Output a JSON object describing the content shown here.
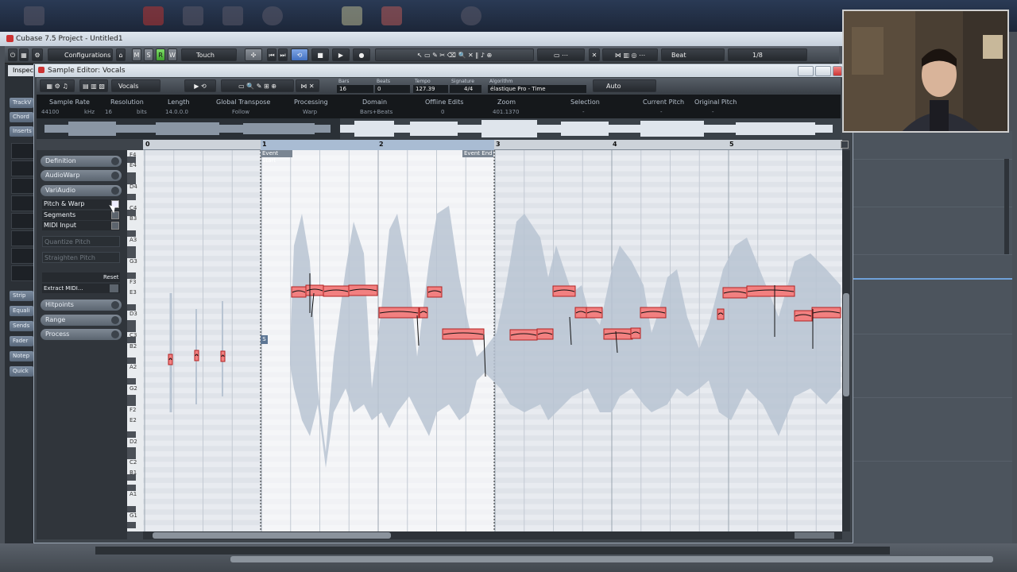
{
  "app": {
    "title": "Cubase 7.5 Project - Untitled1",
    "configurations": "Configurations",
    "automation_mode": "Touch",
    "snap_type": "Beat",
    "quantize": "1/8",
    "mode_buttons": [
      "M",
      "S",
      "R",
      "W"
    ]
  },
  "inspector": {
    "tab": "Inspec",
    "items": [
      "TrackV",
      "Chord",
      "Inserts",
      "Strip",
      "Equali",
      "Sends",
      "Fader",
      "Notep",
      "Quick"
    ]
  },
  "sample_editor": {
    "title": "Sample Editor: Vocals",
    "track": "Vocals",
    "bars_label": "Bars",
    "bars_value": "16",
    "beats_label": "Beats",
    "beats_value": "0",
    "tempo_label": "Tempo",
    "tempo_value": "127.39",
    "signature_label": "Signature",
    "signature_value": "4/4",
    "algorithm_label": "Algorithm",
    "algorithm_value": "élastique Pro - Time",
    "auto_label": "Auto",
    "info": [
      {
        "label": "Sample Rate",
        "value": "44100",
        "unit": "kHz"
      },
      {
        "label": "Resolution",
        "value": "16",
        "unit": "bits"
      },
      {
        "label": "Length",
        "value": "14.0.0.0",
        "unit": ""
      },
      {
        "label": "Global Transpose",
        "value": "Follow",
        "unit": ""
      },
      {
        "label": "Processing",
        "value": "Warp",
        "unit": ""
      },
      {
        "label": "Domain",
        "value": "Bars+Beats",
        "unit": ""
      },
      {
        "label": "Offline Edits",
        "value": "0",
        "unit": ""
      },
      {
        "label": "Zoom",
        "value": "401.1370",
        "unit": ""
      },
      {
        "label": "Selection",
        "value": "-",
        "unit": ""
      },
      {
        "label": "Current Pitch",
        "value": "-",
        "unit": ""
      },
      {
        "label": "Original Pitch",
        "value": "-",
        "unit": ""
      }
    ],
    "ruler_bars": [
      "0",
      "1",
      "2",
      "3",
      "4",
      "5"
    ],
    "event_start": "Event Start",
    "event_end": "Event End",
    "s_marker": "S",
    "sections": {
      "definition": "Definition",
      "audiowarp": "AudioWarp",
      "variaudio": "VariAudio",
      "pitch_warp": "Pitch & Warp",
      "segments": "Segments",
      "midi_input": "MIDI Input",
      "quantize_pitch": "Quantize Pitch",
      "straighten_pitch": "Straighten Pitch",
      "reset": "Reset",
      "extract_midi": "Extract MIDI...",
      "hitpoints": "Hitpoints",
      "range": "Range",
      "process": "Process"
    },
    "piano_labels": [
      "F4",
      "E4",
      "D4",
      "C4",
      "B3",
      "A3",
      "G3",
      "F3",
      "E3",
      "D3",
      "C3",
      "B2",
      "A2",
      "G2",
      "F2",
      "E2",
      "D2",
      "C2",
      "B1",
      "A1",
      "G1"
    ]
  },
  "colors": {
    "segment_fill": "#f28080",
    "segment_border": "#b22222",
    "waveform": "#b8c4d2",
    "selection": "#ffffff"
  }
}
